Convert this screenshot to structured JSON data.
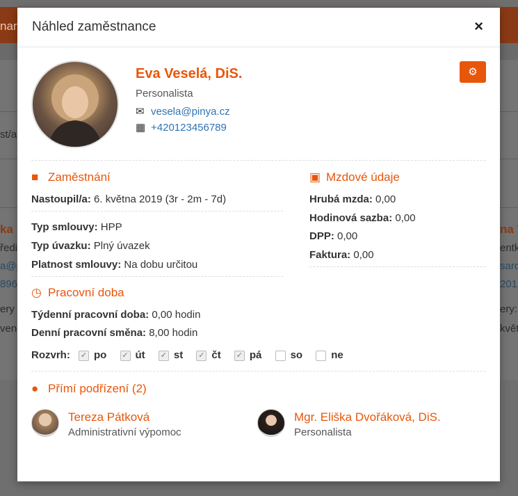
{
  "background": {
    "topbar_fragment": "nar",
    "left_fragments": [
      "st/a",
      "ka",
      "ředi",
      "a@p",
      "896",
      "ery 1",
      "vend"
    ],
    "right_fragments": [
      "na T",
      "entk",
      "sard",
      "201",
      "ery: ú",
      "květ"
    ]
  },
  "modal": {
    "title": "Náhled zaměstnance",
    "close_label": "×"
  },
  "profile": {
    "name": "Eva Veselá, DiS.",
    "role": "Personalista",
    "email": "vesela@pinya.cz",
    "phone": "+420123456789",
    "avatar_icon": "employee-photo",
    "settings_icon": "gears-icon"
  },
  "employment": {
    "title": "Zaměstnání",
    "start_label": "Nastoupil/a:",
    "start_value": "6. května 2019  (3r - 2m - 7d)",
    "contract_type_label": "Typ smlouvy:",
    "contract_type_value": "HPP",
    "workload_label": "Typ úvazku:",
    "workload_value": "Plný úvazek",
    "validity_label": "Platnost smlouvy:",
    "validity_value": "Na dobu určitou"
  },
  "salary": {
    "title": "Mzdové údaje",
    "gross_label": "Hrubá mzda:",
    "gross_value": "0,00",
    "hourly_label": "Hodinová sazba:",
    "hourly_value": "0,00",
    "dpp_label": "DPP:",
    "dpp_value": "0,00",
    "invoice_label": "Faktura:",
    "invoice_value": "0,00"
  },
  "worktime": {
    "title": "Pracovní doba",
    "weekly_label": "Týdenní pracovní doba:",
    "weekly_value": "0,00 hodin",
    "daily_label": "Denní pracovní směna:",
    "daily_value": "8,00 hodin",
    "schedule_label": "Rozvrh:",
    "days": [
      {
        "label": "po",
        "checked": true
      },
      {
        "label": "út",
        "checked": true
      },
      {
        "label": "st",
        "checked": true
      },
      {
        "label": "čt",
        "checked": true
      },
      {
        "label": "pá",
        "checked": true
      },
      {
        "label": "so",
        "checked": false
      },
      {
        "label": "ne",
        "checked": false
      }
    ]
  },
  "subordinates": {
    "title": "Přímí podřízení (2)",
    "items": [
      {
        "name": "Tereza Pátková",
        "role": "Administrativní výpomoc"
      },
      {
        "name": "Mgr. Eliška Dvořáková, DiS.",
        "role": "Personalista"
      }
    ]
  },
  "colors": {
    "accent": "#e8560a",
    "link": "#2e74b5",
    "overlay": "#6e6e6e"
  }
}
